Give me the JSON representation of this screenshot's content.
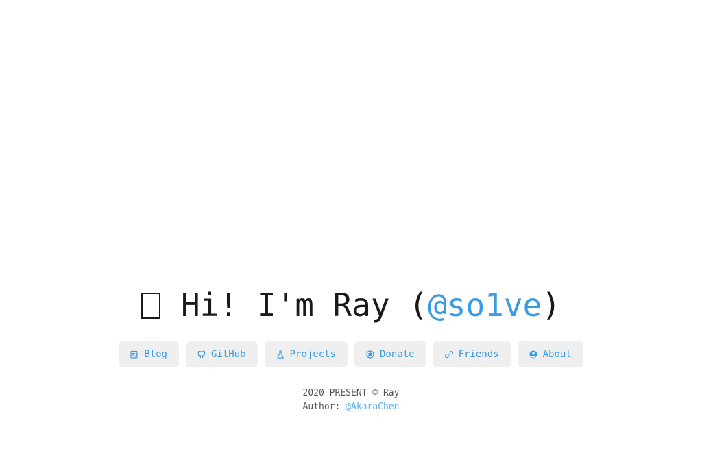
{
  "hero": {
    "greeting": "Hi! I'm Ray (",
    "handle": "@so1ve",
    "closing": ")"
  },
  "nav": {
    "items": [
      {
        "label": "Blog",
        "icon": "edit-note-icon"
      },
      {
        "label": "GitHub",
        "icon": "github-icon"
      },
      {
        "label": "Projects",
        "icon": "flask-icon"
      },
      {
        "label": "Donate",
        "icon": "coin-icon"
      },
      {
        "label": "Friends",
        "icon": "link-icon"
      },
      {
        "label": "About",
        "icon": "user-circle-icon"
      }
    ]
  },
  "footer": {
    "copyright": "2020-PRESENT © Ray",
    "author_prefix": "Author:",
    "author_link": "@AkaraChen"
  },
  "colors": {
    "accent": "#3d9be0",
    "button_bg": "#efefef",
    "text": "#1a1a1a"
  }
}
